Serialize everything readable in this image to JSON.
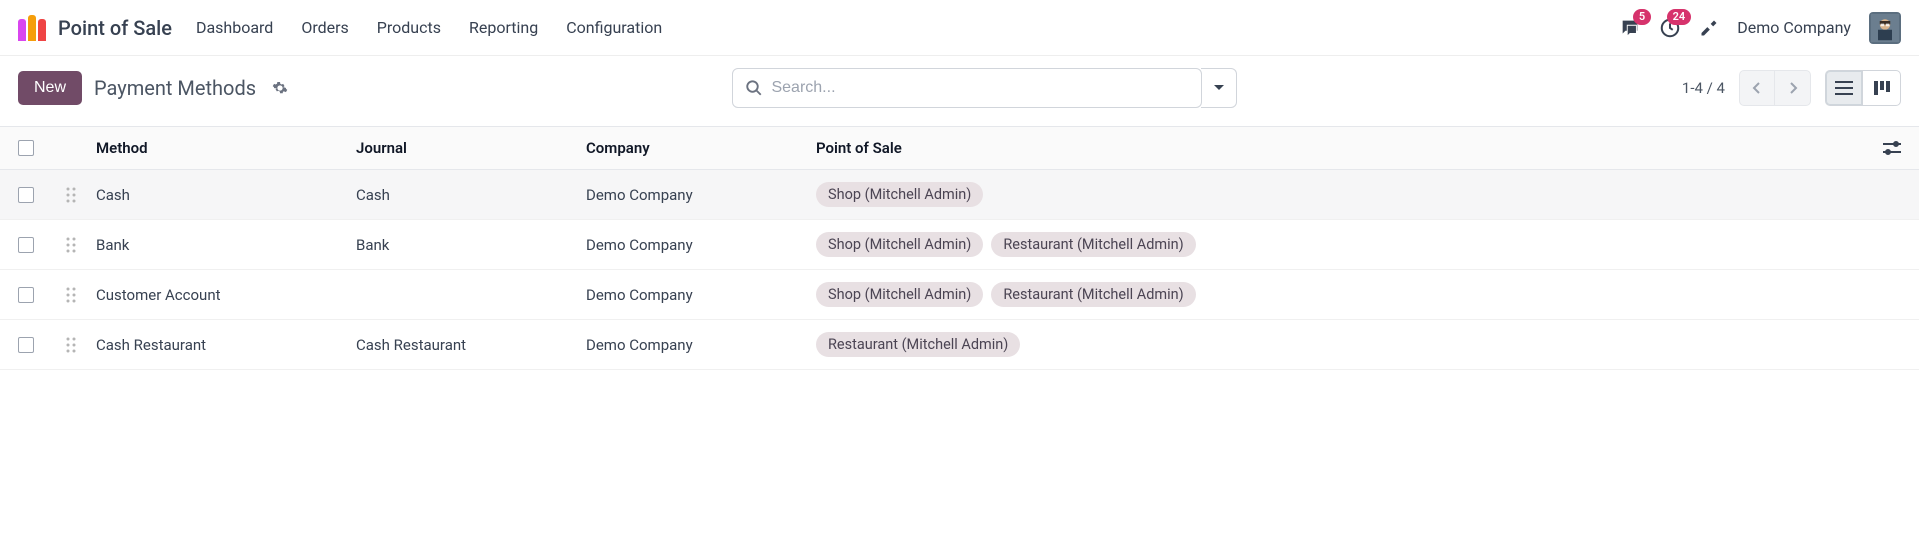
{
  "app": {
    "title": "Point of Sale"
  },
  "nav": {
    "items": [
      "Dashboard",
      "Orders",
      "Products",
      "Reporting",
      "Configuration"
    ]
  },
  "header_right": {
    "messages_badge": "5",
    "activities_badge": "24",
    "company": "Demo Company"
  },
  "control_panel": {
    "new_label": "New",
    "title": "Payment Methods",
    "search_placeholder": "Search...",
    "pager": "1-4 / 4"
  },
  "table": {
    "headers": {
      "method": "Method",
      "journal": "Journal",
      "company": "Company",
      "pos": "Point of Sale"
    },
    "rows": [
      {
        "method": "Cash",
        "journal": "Cash",
        "company": "Demo Company",
        "pos": [
          "Shop (Mitchell Admin)"
        ],
        "hover": true
      },
      {
        "method": "Bank",
        "journal": "Bank",
        "company": "Demo Company",
        "pos": [
          "Shop (Mitchell Admin)",
          "Restaurant (Mitchell Admin)"
        ],
        "hover": false
      },
      {
        "method": "Customer Account",
        "journal": "",
        "company": "Demo Company",
        "pos": [
          "Shop (Mitchell Admin)",
          "Restaurant (Mitchell Admin)"
        ],
        "hover": false
      },
      {
        "method": "Cash Restaurant",
        "journal": "Cash Restaurant",
        "company": "Demo Company",
        "pos": [
          "Restaurant (Mitchell Admin)"
        ],
        "hover": false
      }
    ]
  }
}
